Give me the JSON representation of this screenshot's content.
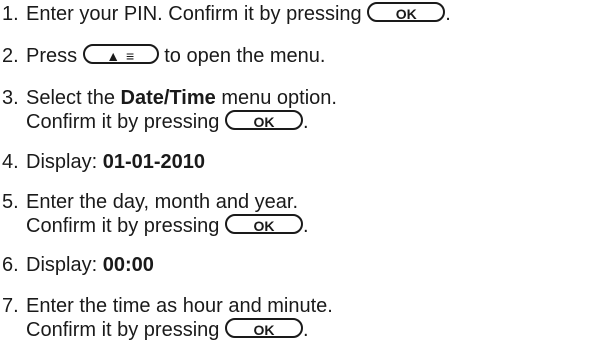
{
  "steps": [
    {
      "num": "1.",
      "pre": "Enter your PIN. Confirm it by pressing",
      "key": "OK",
      "post": "."
    },
    {
      "num": "2.",
      "pre": "Press",
      "key": "▲ ≡",
      "post": "to open the menu."
    },
    {
      "num": "3.",
      "pre": "Select the",
      "bold": "Date/Time",
      "post": "menu option.",
      "line2_pre": "Confirm it by pressing",
      "line2_key": "OK",
      "line2_post": "."
    },
    {
      "num": "4.",
      "pre": "Display:",
      "bold": "01-01-2010"
    },
    {
      "num": "5.",
      "pre": "Enter the day, month and year.",
      "line2_pre": "Confirm it by pressing",
      "line2_key": "OK",
      "line2_post": "."
    },
    {
      "num": "6.",
      "pre": "Display:",
      "bold": "00:00"
    },
    {
      "num": "7.",
      "pre": "Enter the time as hour and minute.",
      "line2_pre": "Confirm it by pressing",
      "line2_key": "OK",
      "line2_post": "."
    }
  ]
}
